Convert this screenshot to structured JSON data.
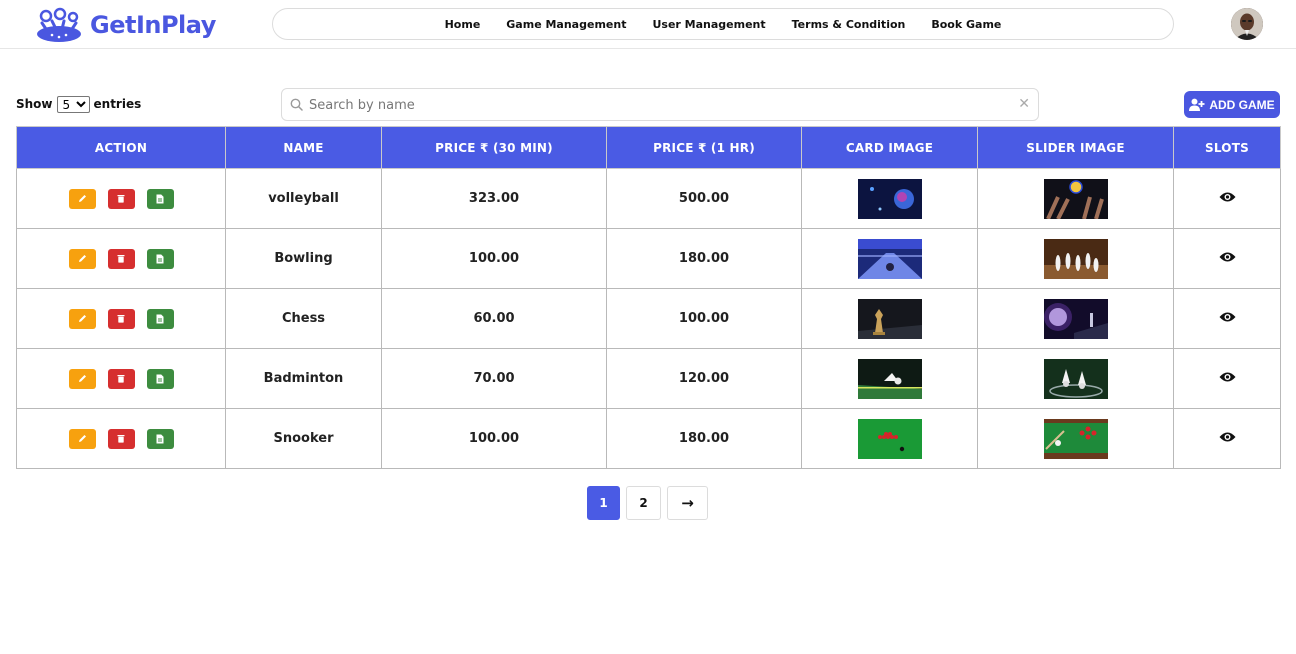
{
  "app": {
    "brand": "GetInPlay"
  },
  "nav": [
    "Home",
    "Game Management",
    "User Management",
    "Terms & Condition",
    "Book Game"
  ],
  "controls": {
    "show_label": "Show",
    "entries_label": "entries",
    "entries_value": "5",
    "search_placeholder": "Search by name",
    "add_label": "ADD GAME"
  },
  "table": {
    "headers": [
      "ACTION",
      "NAME",
      "PRICE ₹ (30 MIN)",
      "PRICE ₹ (1 HR)",
      "CARD IMAGE",
      "SLIDER IMAGE",
      "SLOTS"
    ],
    "rows": [
      {
        "name": "volleyball",
        "price30": "323.00",
        "price60": "500.00"
      },
      {
        "name": "Bowling",
        "price30": "100.00",
        "price60": "180.00"
      },
      {
        "name": "Chess",
        "price30": "60.00",
        "price60": "100.00"
      },
      {
        "name": "Badminton",
        "price30": "70.00",
        "price60": "120.00"
      },
      {
        "name": "Snooker",
        "price30": "100.00",
        "price60": "180.00"
      }
    ]
  },
  "pagination": {
    "pages": [
      "1",
      "2"
    ],
    "active": "1",
    "next": "→"
  },
  "colors": {
    "accent": "#4a57e0",
    "edit": "#f7a10f",
    "delete": "#d62f2f",
    "doc": "#3d8c3f"
  }
}
